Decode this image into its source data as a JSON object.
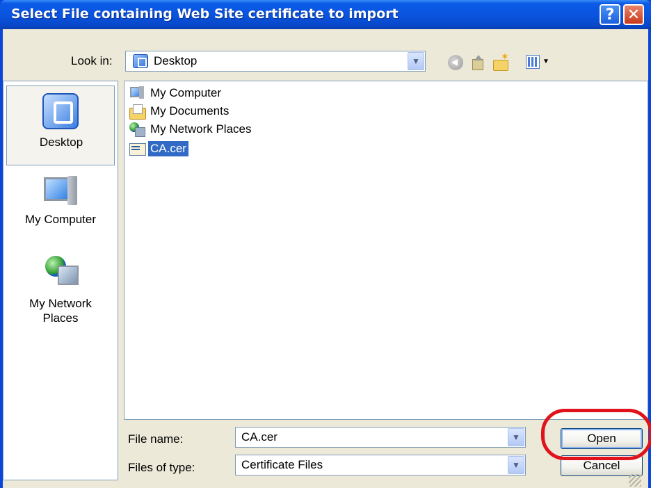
{
  "window": {
    "title": "Select File containing Web Site certificate to import",
    "help_label": "?",
    "close_label": "✕"
  },
  "toolbar": {
    "look_in_label": "Look in:",
    "look_in_value": "Desktop",
    "icons": [
      "back-icon",
      "up-folder-icon",
      "new-folder-icon",
      "views-menu-icon"
    ]
  },
  "places": [
    {
      "label": "Desktop",
      "icon": "desktop-icon",
      "selected": true
    },
    {
      "label": "My Computer",
      "icon": "my-computer-icon"
    },
    {
      "label": "My Network Places",
      "icon": "network-places-icon"
    }
  ],
  "files": [
    {
      "name": "My Computer",
      "icon": "my-computer-icon"
    },
    {
      "name": "My Documents",
      "icon": "my-documents-icon"
    },
    {
      "name": "My Network Places",
      "icon": "network-places-icon"
    },
    {
      "name": "CA.cer",
      "icon": "certificate-file-icon",
      "selected": true
    }
  ],
  "form": {
    "file_name_label": "File name:",
    "file_name_value": "CA.cer",
    "file_type_label": "Files of type:",
    "file_type_value": "Certificate Files"
  },
  "buttons": {
    "open": "Open",
    "cancel": "Cancel"
  },
  "colors": {
    "title_bar": "#0a55e0",
    "selection": "#316ac5",
    "highlight_ring": "#e0121a",
    "dialog_bg": "#ece9d8"
  }
}
